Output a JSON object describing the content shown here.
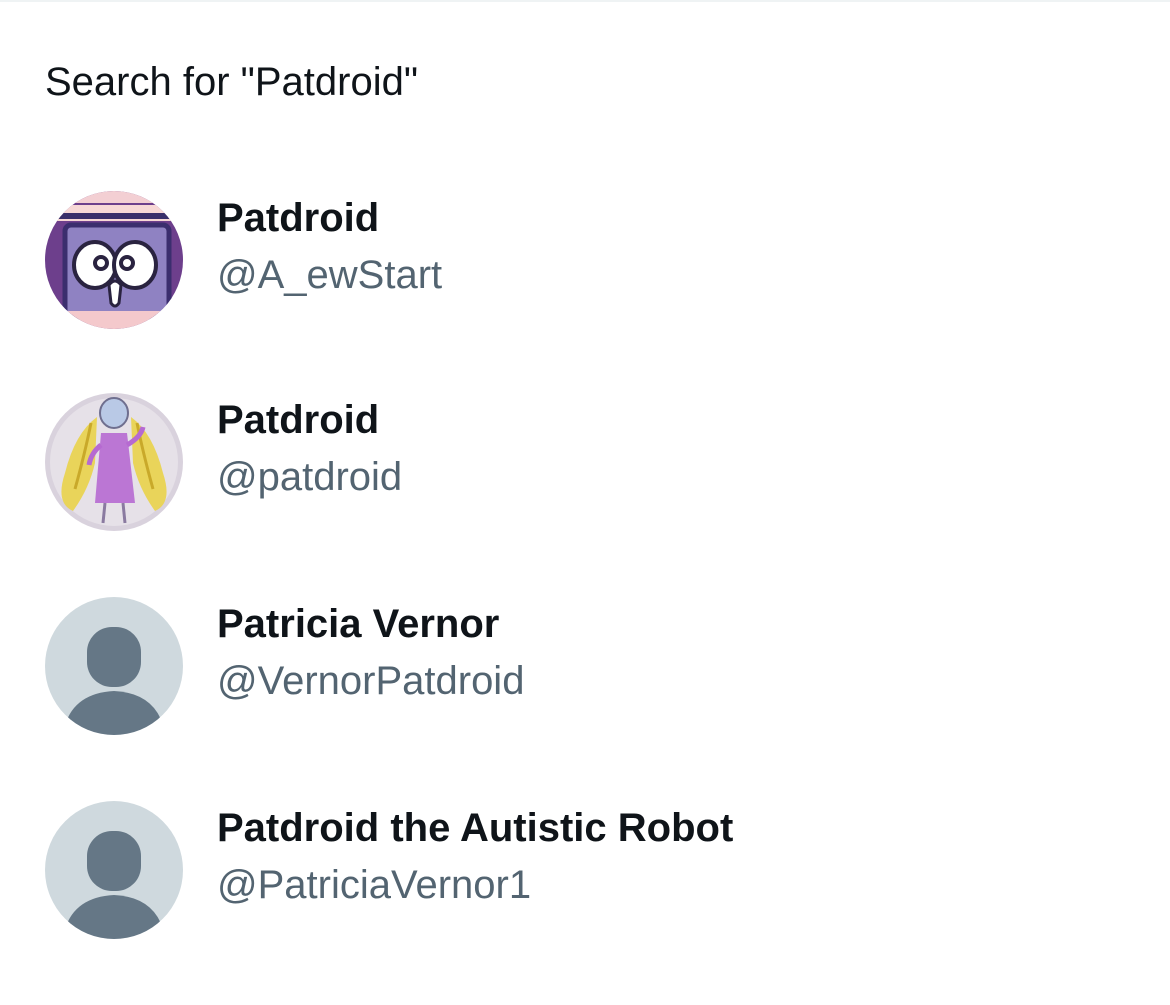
{
  "search_suggestion": {
    "label": "Search for \"Patdroid\""
  },
  "results": [
    {
      "name": "Patdroid",
      "handle": "@A_ewStart",
      "avatar": "cartoon-robot-avatar"
    },
    {
      "name": "Patdroid",
      "handle": "@patdroid",
      "avatar": "drawing-girl-avatar"
    },
    {
      "name": "Patricia Vernor",
      "handle": "@VernorPatdroid",
      "avatar": "default-profile-avatar"
    },
    {
      "name": "Patdroid the Autistic Robot",
      "handle": "@PatriciaVernor1",
      "avatar": "default-profile-avatar"
    }
  ],
  "colors": {
    "primary_text": "#0f1419",
    "secondary_text": "#536471",
    "default_avatar_bg": "#cfd9de",
    "default_avatar_fg": "#657786",
    "divider": "#eff3f4"
  }
}
